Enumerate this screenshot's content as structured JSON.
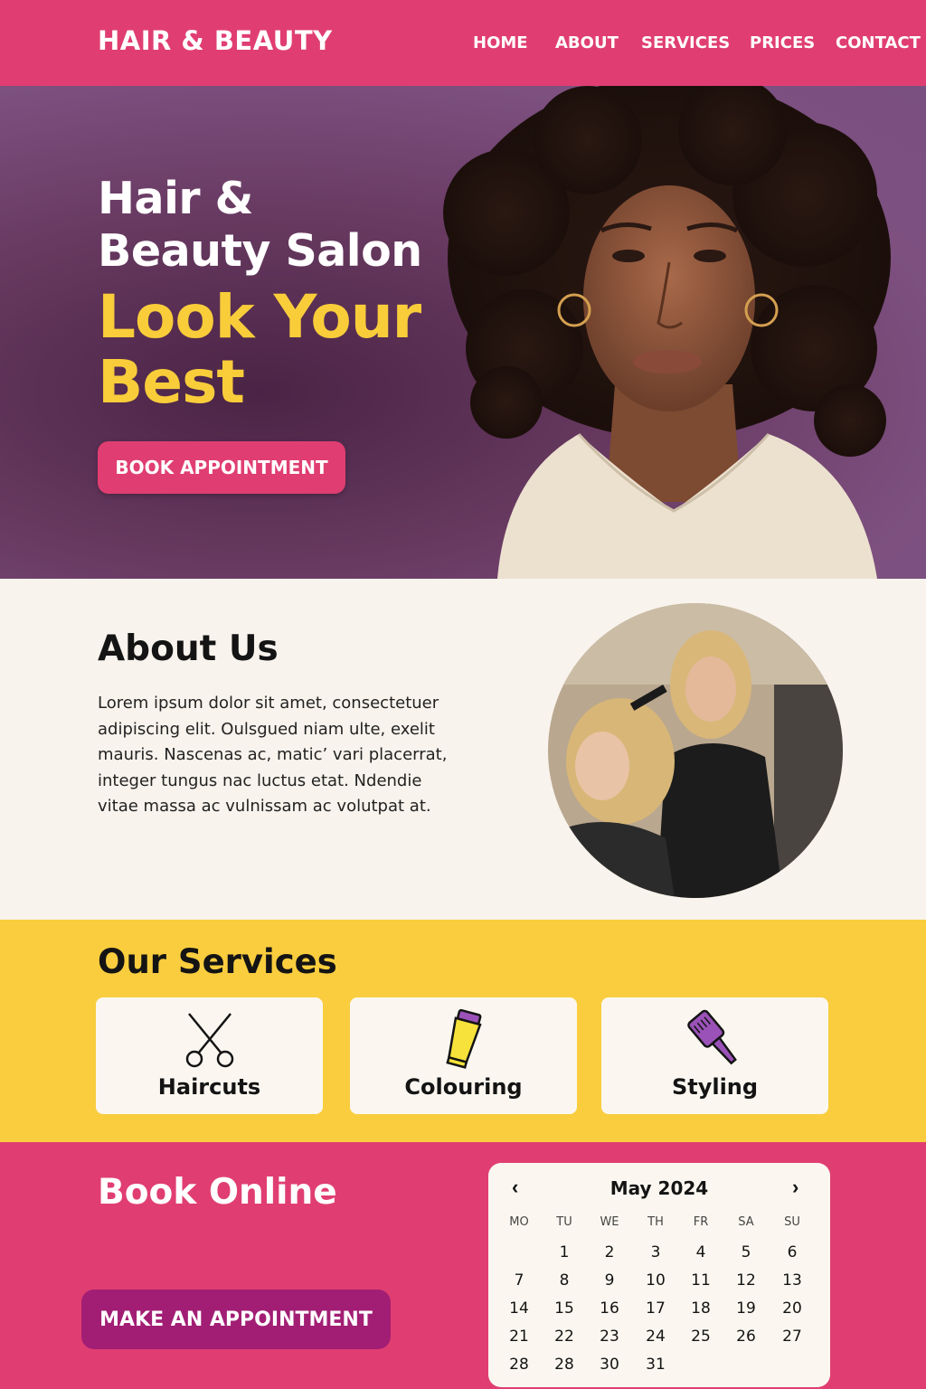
{
  "brand": {
    "name": "HAIR & BEAUTY"
  },
  "nav": [
    {
      "label": "HOME"
    },
    {
      "label": "ABOUT"
    },
    {
      "label": "SERVICES"
    },
    {
      "label": "PRICES"
    },
    {
      "label": "CONTACT"
    }
  ],
  "hero": {
    "title": "Hair & Beauty Salon",
    "tagline": "Look Your Best",
    "cta": "BOOK APPOINTMENT"
  },
  "about": {
    "title": "About Us",
    "text": "Lorem ipsum dolor sit amet, consectetuer adipiscing elit. Oulsgued niam ulte, exelit mauris. Nascenas ac, matic’ vari placerrat, integer tungus nac luctus etat. Ndendie vitae massa ac vulnissam ac volutpat at."
  },
  "services": {
    "title": "Our Services",
    "items": [
      {
        "label": "Haircuts",
        "icon": "scissors-icon"
      },
      {
        "label": "Colouring",
        "icon": "hair-dye-tube-icon"
      },
      {
        "label": "Styling",
        "icon": "hair-brush-icon"
      }
    ]
  },
  "booking": {
    "title": "Book Online",
    "cta": "MAKE AN APPOINTMENT",
    "calendar": {
      "month": "May 2024",
      "prev": "‹",
      "next": "›",
      "weekdays": [
        "MO",
        "TU",
        "WE",
        "TH",
        "FR",
        "SA",
        "SU"
      ],
      "weeks": [
        [
          "",
          "1",
          "2",
          "3",
          "4",
          "5",
          "6"
        ],
        [
          "7",
          "8",
          "9",
          "10",
          "11",
          "12",
          "13"
        ],
        [
          "14",
          "15",
          "16",
          "17",
          "18",
          "19",
          "20"
        ],
        [
          "21",
          "22",
          "23",
          "24",
          "25",
          "26",
          "27"
        ],
        [
          "28",
          "28",
          "30",
          "31",
          "",
          "",
          ""
        ]
      ]
    }
  },
  "colors": {
    "primary_pink": "#e03e72",
    "accent_yellow": "#f9cd3a",
    "hero_purple": "#66385f",
    "button_magenta": "#a21e74"
  }
}
